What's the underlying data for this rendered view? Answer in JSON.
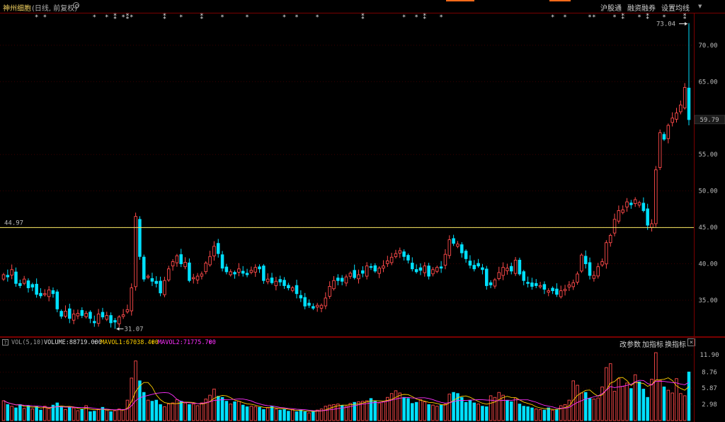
{
  "header": {
    "stock_name": "神州细胞",
    "subtitle": "(日线, 前复权)",
    "buttons": [
      "沪股通",
      "融资融券",
      "设置均线"
    ]
  },
  "vol_header": {
    "indicator": "VOL(5,10)",
    "volume": "VOLUME:88719.000",
    "mavol1": "MAVOL1:67038.400",
    "mavol2": "MAVOL2:71775.700",
    "buttons": [
      "改参数",
      "加指标",
      "换指标"
    ],
    "help": "?",
    "close": "×"
  },
  "colors": {
    "up": "#ff4a4a",
    "down": "#00e0ff",
    "mavol1": "#ffd000",
    "mavol2": "#ff30ff",
    "reference": "#ffee66",
    "text": "#bbbbbb"
  },
  "chart_data": [
    {
      "type": "candlestick",
      "title": "神州细胞",
      "yticks": [
        35.0,
        40.0,
        45.0,
        50.0,
        55.0,
        65.0,
        70.0
      ],
      "ylim": [
        30.0,
        75.0
      ],
      "grid": true,
      "reference_line": {
        "value": 44.97,
        "label": "44.97"
      },
      "last_price": {
        "value": 59.79,
        "label": "59.79"
      },
      "annotations": [
        {
          "text": "73.04",
          "marks": "high"
        },
        {
          "text": "31.07",
          "marks": "low"
        }
      ],
      "event_marks": "asterisks along top edge",
      "close": [
        38.5,
        38.2,
        39.2,
        37.3,
        37.0,
        37.9,
        36.7,
        36.8,
        35.8,
        35.6,
        35.9,
        36.4,
        35.9,
        33.8,
        32.8,
        33.5,
        32.5,
        33.1,
        33.2,
        32.9,
        33.2,
        32.5,
        31.9,
        33.1,
        32.7,
        32.9,
        31.9,
        32.0,
        32.7,
        33.0,
        33.7,
        36.7,
        46.5,
        41.0,
        37.9,
        38.3,
        37.6,
        37.3,
        36.0,
        37.7,
        39.3,
        40.3,
        41.1,
        40.0,
        40.2,
        37.7,
        38.1,
        38.3,
        38.6,
        40.1,
        41.0,
        42.4,
        41.4,
        39.4,
        38.9,
        38.9,
        38.6,
        39.3,
        38.7,
        38.5,
        39.1,
        39.5,
        39.3,
        37.7,
        37.9,
        37.4,
        37.6,
        37.5,
        37.0,
        36.7,
        36.7,
        35.9,
        35.3,
        34.2,
        34.3,
        33.9,
        34.3,
        34.3,
        35.3,
        36.9,
        37.7,
        37.7,
        37.6,
        38.2,
        38.7,
        38.1,
        38.5,
        38.7,
        39.7,
        39.5,
        39.0,
        39.4,
        39.7,
        40.4,
        40.9,
        41.4,
        41.8,
        41.0,
        40.5,
        39.3,
        38.9,
        39.1,
        39.7,
        38.3,
        39.2,
        39.5,
        39.4,
        41.3,
        43.3,
        42.8,
        42.7,
        41.5,
        40.7,
        39.8,
        39.3,
        39.7,
        39.2,
        37.0,
        37.1,
        37.8,
        38.8,
        39.5,
        39.4,
        39.0,
        40.5,
        38.6,
        37.7,
        37.3,
        36.9,
        37.0,
        37.0,
        36.5,
        36.3,
        36.3,
        35.8,
        36.3,
        36.5,
        37.1,
        37.4,
        38.6,
        41.2,
        40.0,
        38.4,
        38.4,
        39.6,
        40.3,
        42.9,
        43.9,
        46.1,
        47.3,
        47.4,
        48.5,
        48.1,
        48.8,
        48.4,
        47.3,
        45.3,
        45.5,
        52.9,
        58.0,
        57.1,
        59.0,
        60.0,
        60.7,
        61.8,
        64.2,
        59.79
      ],
      "high": 73.04,
      "low": 31.07
    },
    {
      "type": "bar",
      "title": "VOL(5,10)",
      "series": [
        {
          "name": "VOLUME",
          "last": 88719.0
        },
        {
          "name": "MAVOL1",
          "last": 67038.4
        },
        {
          "name": "MAVOL2",
          "last": 71775.7
        }
      ],
      "yticks": [
        2.98,
        5.87,
        8.76,
        11.9
      ],
      "ylim": [
        0,
        12.9
      ],
      "volumes": [
        3.6,
        2.9,
        2.6,
        2.3,
        2.9,
        2.2,
        2.7,
        2.1,
        2.5,
        1.9,
        2.6,
        2.2,
        2.8,
        3.2,
        2.5,
        2.0,
        2.4,
        2.3,
        1.8,
        2.0,
        2.7,
        1.6,
        1.7,
        2.0,
        2.4,
        1.9,
        1.6,
        1.8,
        2.1,
        2.0,
        3.7,
        7.7,
        10.8,
        7.2,
        5.1,
        3.7,
        3.5,
        3.7,
        2.9,
        2.5,
        3.0,
        3.2,
        3.8,
        3.5,
        3.2,
        2.9,
        3.0,
        2.7,
        3.2,
        3.9,
        4.6,
        5.7,
        4.4,
        4.2,
        3.5,
        3.0,
        3.4,
        3.5,
        2.8,
        2.5,
        2.6,
        2.5,
        2.4,
        2.0,
        2.3,
        2.6,
        2.1,
        1.9,
        2.0,
        1.7,
        2.0,
        1.6,
        1.9,
        1.6,
        1.4,
        1.7,
        1.9,
        2.1,
        2.6,
        2.8,
        2.9,
        3.0,
        2.7,
        2.6,
        3.1,
        3.3,
        3.4,
        3.5,
        3.6,
        4.0,
        3.5,
        3.2,
        3.4,
        4.2,
        4.9,
        5.4,
        5.0,
        4.2,
        4.0,
        3.1,
        3.3,
        3.8,
        3.4,
        2.9,
        2.8,
        2.6,
        2.8,
        3.0,
        4.8,
        5.1,
        4.9,
        4.2,
        3.3,
        3.6,
        3.2,
        3.0,
        2.6,
        2.5,
        4.5,
        4.2,
        5.1,
        4.6,
        3.6,
        3.4,
        4.1,
        3.0,
        2.6,
        2.5,
        2.3,
        2.1,
        2.0,
        1.9,
        2.3,
        1.9,
        2.0,
        2.7,
        2.9,
        3.7,
        7.2,
        6.4,
        5.0,
        5.1,
        4.0,
        3.9,
        4.1,
        6.1,
        9.6,
        10.3,
        5.3,
        7.6,
        6.2,
        6.8,
        5.8,
        8.3,
        7.0,
        5.7,
        4.2,
        7.5,
        12.3,
        7.3,
        6.1,
        5.5,
        5.0,
        7.6,
        4.9,
        4.5,
        8.8
      ]
    }
  ]
}
